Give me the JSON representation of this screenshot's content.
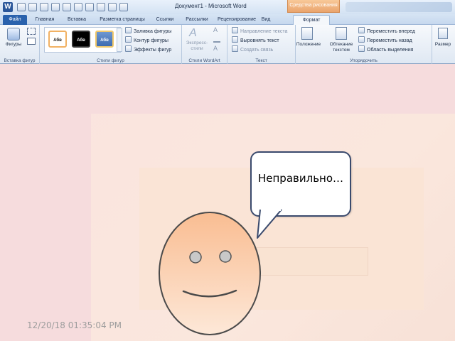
{
  "window": {
    "title": "Документ1 - Microsoft Word",
    "contextual_tab_group": "Средства рисования",
    "app_icon": "W"
  },
  "tabs": [
    {
      "label": "Файл",
      "name": "tab-file"
    },
    {
      "label": "Главная",
      "name": "tab-home"
    },
    {
      "label": "Вставка",
      "name": "tab-insert"
    },
    {
      "label": "Разметка страницы",
      "name": "tab-page-layout"
    },
    {
      "label": "Ссылки",
      "name": "tab-references"
    },
    {
      "label": "Рассылки",
      "name": "tab-mailings"
    },
    {
      "label": "Рецензирование",
      "name": "tab-review"
    },
    {
      "label": "Вид",
      "name": "tab-view"
    },
    {
      "label": "Формат",
      "name": "tab-format"
    }
  ],
  "ribbon": {
    "insert_shapes": {
      "shapes_label": "Фигуры",
      "group_label": "Вставка фигур"
    },
    "shape_styles": {
      "style_sample": "Абв",
      "fill": "Заливка фигуры",
      "outline": "Контур фигуры",
      "effects": "Эффекты фигур",
      "group_label": "Стили фигур"
    },
    "wordart": {
      "express_styles": "Экспресс-стили",
      "group_label": "Стили WordArt"
    },
    "text": {
      "direction": "Направление текста",
      "align": "Выровнять текст",
      "link": "Создать связь",
      "group_label": "Текст"
    },
    "arrange": {
      "position": "Положение",
      "wrap": "Обтекание текстом",
      "bring_forward": "Переместить вперед",
      "send_backward": "Переместить назад",
      "selection_pane": "Область выделения",
      "group_label": "Упорядочить"
    },
    "size": {
      "label": "Размер"
    }
  },
  "slide": {
    "speech_text": "Неправильно…",
    "timestamp": "12/20/18 01:35:04 PM"
  },
  "colors": {
    "slide_background": "#f6dcdd",
    "bubble_border": "#3a4a6d",
    "face_top": "#f9bd92",
    "face_bottom": "#fde8d8",
    "face_outline": "#4a4a4a",
    "eye_fill": "#c8c8c8"
  }
}
